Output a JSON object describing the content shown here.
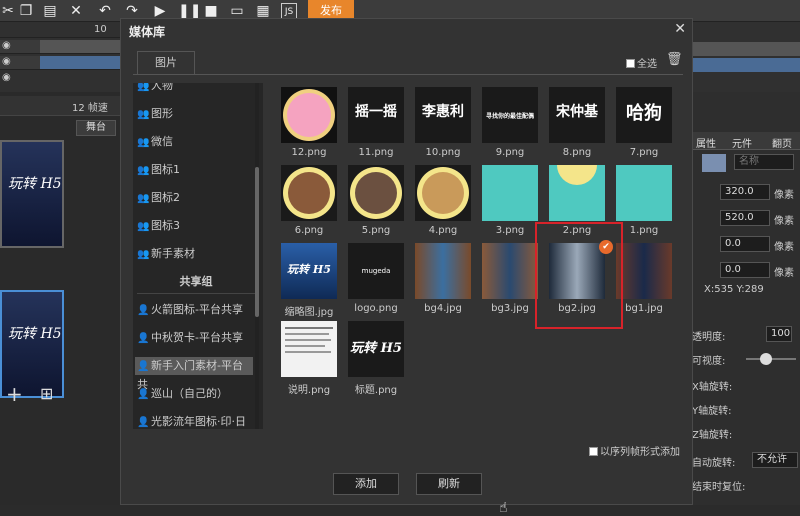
{
  "toolbar": {
    "publish_label": "发布",
    "icons": [
      "cut-icon",
      "copy-icon",
      "paste-icon",
      "delete-icon",
      "undo-icon",
      "redo-icon",
      "play-icon",
      "pause-icon",
      "stop-icon",
      "preview-icon",
      "qr-icon",
      "js-icon"
    ]
  },
  "timeline": {
    "ruler_label": "10",
    "fps_label": "12 帧速",
    "stage_tab": "舞台"
  },
  "dialog": {
    "title": "媒体库",
    "tab_label": "图片",
    "select_all_label": "全选",
    "sequence_add_label": "以序列帧形式添加",
    "add_button": "添加",
    "refresh_button": "刷新",
    "categories": [
      {
        "label": "人物"
      },
      {
        "label": "图形"
      },
      {
        "label": "微信"
      },
      {
        "label": "图标1"
      },
      {
        "label": "图标2"
      },
      {
        "label": "图标3"
      },
      {
        "label": "新手素材"
      }
    ],
    "shared_group_label": "共享组",
    "shared_items": [
      {
        "label": "火箭图标-平台共享"
      },
      {
        "label": "中秋贺卡-平台共享"
      },
      {
        "label": "新手入门素材-平台共"
      },
      {
        "label": "巡山（自己的）"
      },
      {
        "label": "光影流年图标·印·日"
      }
    ],
    "images": [
      {
        "name": "12.png",
        "thumb_text": ""
      },
      {
        "name": "11.png",
        "thumb_text": "摇一摇"
      },
      {
        "name": "10.png",
        "thumb_text": "李惠利"
      },
      {
        "name": "9.png",
        "thumb_text": "寻找你的最佳配偶"
      },
      {
        "name": "8.png",
        "thumb_text": "宋仲基"
      },
      {
        "name": "7.png",
        "thumb_text": "哈狗"
      },
      {
        "name": "6.png",
        "thumb_text": ""
      },
      {
        "name": "5.png",
        "thumb_text": ""
      },
      {
        "name": "4.png",
        "thumb_text": ""
      },
      {
        "name": "3.png",
        "thumb_text": ""
      },
      {
        "name": "2.png",
        "thumb_text": ""
      },
      {
        "name": "1.png",
        "thumb_text": ""
      },
      {
        "name": "缩略图.jpg",
        "thumb_text": "玩转 H5"
      },
      {
        "name": "logo.png",
        "thumb_text": "mugeda"
      },
      {
        "name": "bg4.jpg",
        "thumb_text": ""
      },
      {
        "name": "bg3.jpg",
        "thumb_text": ""
      },
      {
        "name": "bg2.jpg",
        "thumb_text": ""
      },
      {
        "name": "bg1.jpg",
        "thumb_text": ""
      },
      {
        "name": "说明.png",
        "thumb_text": ""
      },
      {
        "name": "标题.png",
        "thumb_text": "玩转 H5"
      }
    ]
  },
  "left_thumbs": {
    "text": "玩转 H5"
  },
  "properties": {
    "tabs": [
      "属性",
      "元件",
      "翻页"
    ],
    "name_placeholder": "名称",
    "x_value": "320.0",
    "y_value": "520.0",
    "w_value": "0.0",
    "h_value": "0.0",
    "unit": "像素",
    "coords": "X:535  Y:289",
    "opacity_label": "透明度:",
    "opacity_value": "100",
    "visibility_label": "可视度:",
    "xrot_label": "X轴旋转:",
    "yrot_label": "Y轴旋转:",
    "zrot_label": "Z轴旋转:",
    "autorot_label": "自动旋转:",
    "autorot_value": "不允许",
    "reset_label": "结束时复位:",
    "colors": {
      "accent": "#e8862b",
      "selection": "#d8232a",
      "link": "#4a8fd6"
    }
  }
}
